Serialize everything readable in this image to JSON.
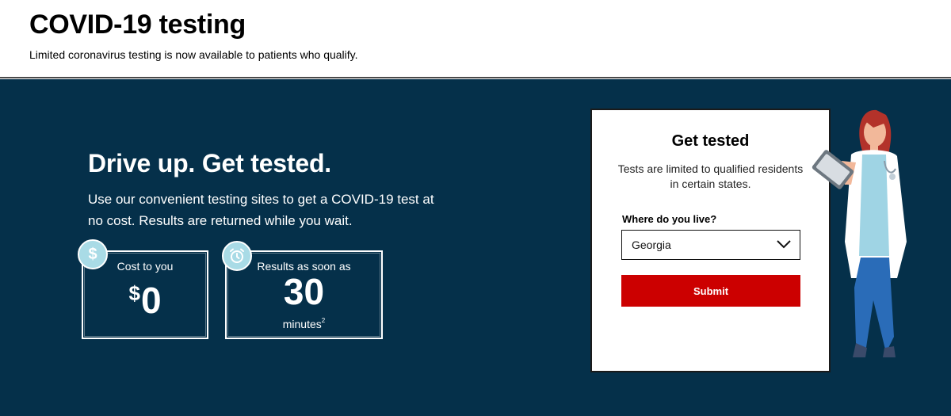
{
  "header": {
    "title": "COVID-19 testing",
    "subtitle": "Limited coronavirus testing is now available to patients who qualify."
  },
  "hero": {
    "heading": "Drive up. Get tested.",
    "body": "Use our convenient testing sites to get a COVID-19 test at no cost. Results are returned while you wait.",
    "stats": {
      "cost": {
        "label": "Cost to you",
        "currency": "$",
        "value": "0",
        "icon": "dollar-icon"
      },
      "results": {
        "label": "Results as soon as",
        "value": "30",
        "unit": "minutes",
        "footnote": "2",
        "icon": "alarm-clock-icon"
      }
    }
  },
  "form": {
    "title": "Get tested",
    "description": "Tests are limited to qualified residents in certain states.",
    "location_label": "Where do you live?",
    "selected_state": "Georgia",
    "submit_label": "Submit"
  },
  "colors": {
    "hero_bg": "#05304a",
    "accent_red": "#cc0000",
    "badge_bg": "#a9dbe6"
  },
  "illustration": {
    "icon": "doctor-with-clipboard-illustration"
  }
}
